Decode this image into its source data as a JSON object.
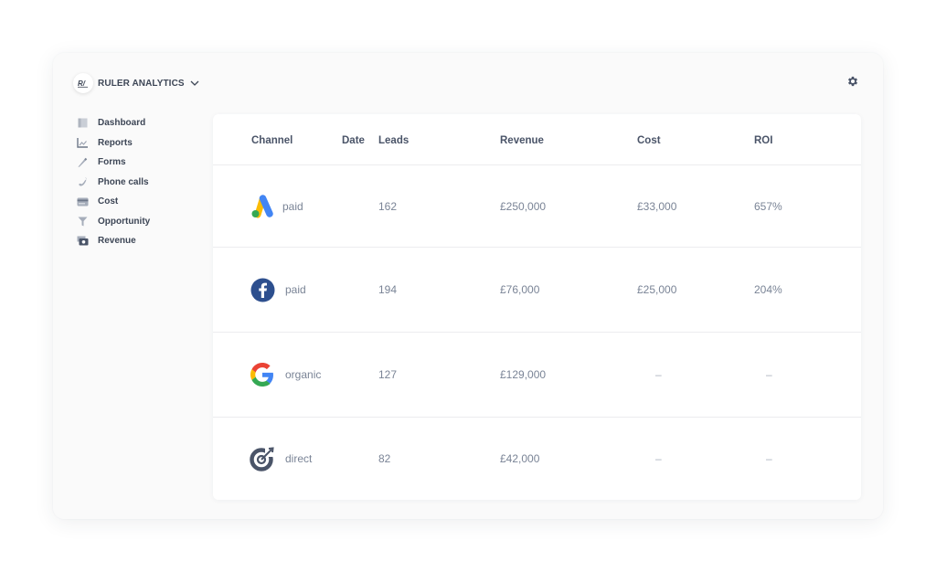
{
  "app": {
    "brand_name": "RULER ANALYTICS",
    "brand_logo_text": "R/",
    "settings_icon": "gear-icon"
  },
  "sidebar": {
    "items": [
      {
        "label": "Dashboard",
        "icon": "dashboard-icon"
      },
      {
        "label": "Reports",
        "icon": "chart-icon"
      },
      {
        "label": "Forms",
        "icon": "pencil-icon"
      },
      {
        "label": "Phone calls",
        "icon": "phone-icon"
      },
      {
        "label": "Cost",
        "icon": "credit-card-icon"
      },
      {
        "label": "Opportunity",
        "icon": "funnel-icon"
      },
      {
        "label": "Revenue",
        "icon": "cash-icon"
      }
    ]
  },
  "table": {
    "headers": {
      "channel": "Channel",
      "date": "Date",
      "leads": "Leads",
      "revenue": "Revenue",
      "cost": "Cost",
      "roi": "ROI"
    },
    "rows": [
      {
        "source_icon": "google-ads-icon",
        "channel": "paid",
        "leads": "162",
        "revenue": "£250,000",
        "cost": "£33,000",
        "roi": "657%"
      },
      {
        "source_icon": "facebook-icon",
        "channel": "paid",
        "leads": "194",
        "revenue": "£76,000",
        "cost": "£25,000",
        "roi": "204%"
      },
      {
        "source_icon": "google-icon",
        "channel": "organic",
        "leads": "127",
        "revenue": "£129,000",
        "cost": "–",
        "roi": "–"
      },
      {
        "source_icon": "target-icon",
        "channel": "direct",
        "leads": "82",
        "revenue": "£42,000",
        "cost": "–",
        "roi": "–"
      }
    ]
  },
  "colors": {
    "text_dark": "#3d4656",
    "text_muted": "#7a8496",
    "facebook_blue": "#2d4f8e",
    "google_blue": "#4285f4",
    "google_red": "#ea4335",
    "google_yellow": "#fbbc04",
    "google_green": "#34a853",
    "icon_slate": "#4a5468"
  }
}
